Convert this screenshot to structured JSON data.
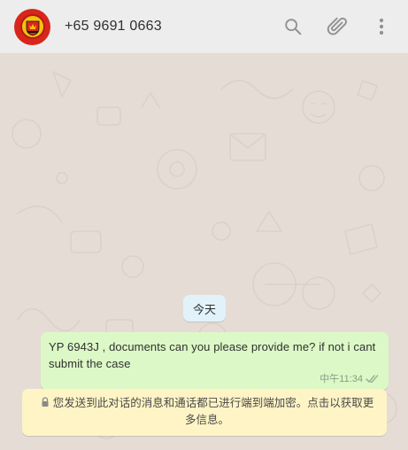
{
  "header": {
    "contact_name": "+65 9691 0663",
    "avatar_icon": "manchester-united-crest",
    "actions": [
      "search-icon",
      "paperclip-icon",
      "more-vertical-icon"
    ]
  },
  "chat": {
    "date_label": "今天",
    "messages": [
      {
        "text": "YP 6943J , documents can you please provide me? if not i cant submit the case",
        "time": "中午11:34",
        "status": "delivered-double-check"
      }
    ],
    "encryption_notice": "您发送到此对话的消息和通话都已进行端到端加密。点击以获取更多信息。"
  },
  "colors": {
    "header_bg": "#ededed",
    "chat_bg": "#e5ddd5",
    "outgoing_bubble": "#dcf8c6",
    "date_chip": "#e1f2fb",
    "notice_bg": "#fef4c5"
  }
}
